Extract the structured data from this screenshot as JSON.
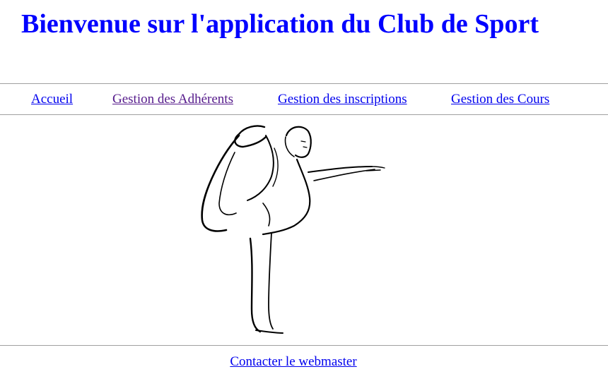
{
  "header": {
    "title": "Bienvenue sur l'application du Club de Sport"
  },
  "nav": {
    "items": [
      {
        "label": "Accueil",
        "visited": false
      },
      {
        "label": "Gestion des Adhérents",
        "visited": true
      },
      {
        "label": "Gestion des inscriptions",
        "visited": false
      },
      {
        "label": "Gestion des Cours",
        "visited": false
      }
    ]
  },
  "main": {
    "illustration": "dancer-pose-line-drawing"
  },
  "footer": {
    "contact_label": "Contacter le webmaster"
  },
  "colors": {
    "title": "#0000ff",
    "link": "#0000ee",
    "visited_link": "#551a8b",
    "rule": "#a0a0a0"
  }
}
